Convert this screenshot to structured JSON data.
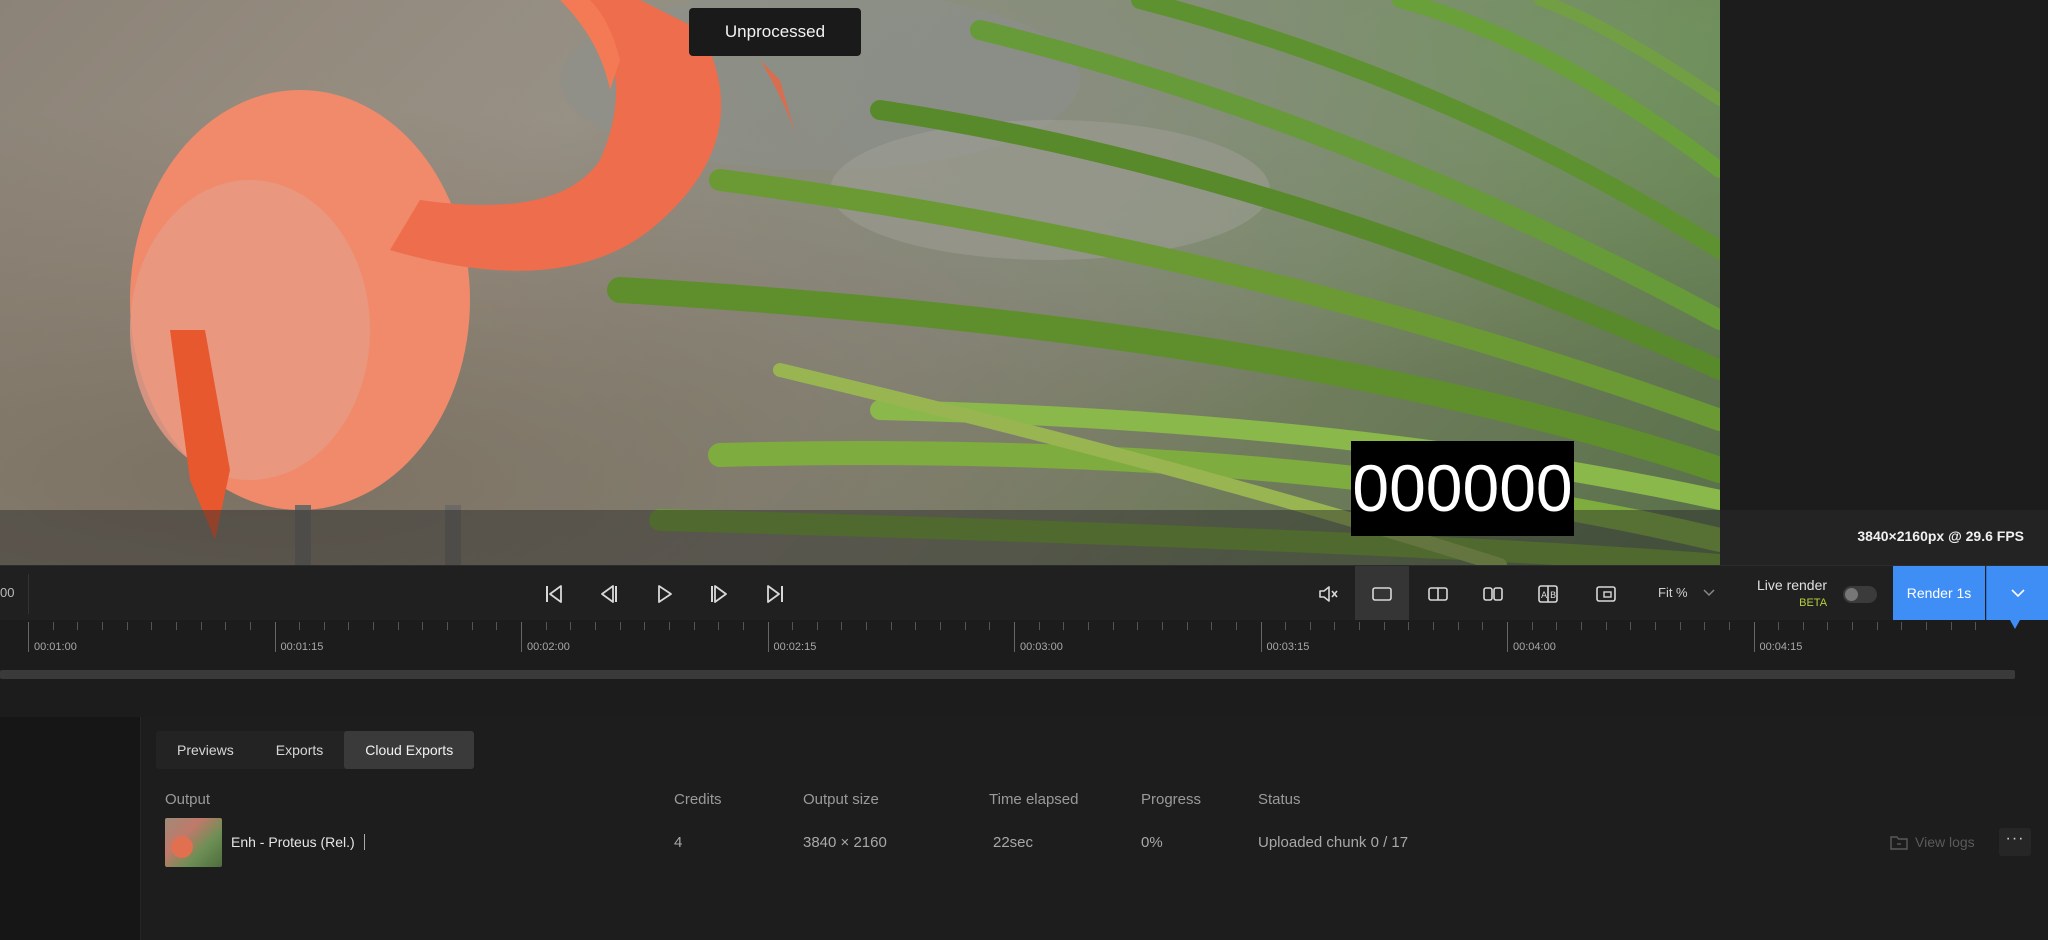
{
  "preview": {
    "comparison_label": "Unprocessed",
    "frame_counter": "000000",
    "resolution": "3840×2160px @ 29.6 FPS"
  },
  "toolbar": {
    "left_time_fragment": "00",
    "fit_label": "Fit %",
    "live_render_label": "Live render",
    "live_render_badge": "BETA",
    "live_render_enabled": false,
    "render_button_label": "Render 1s",
    "icons": {
      "first_frame": "skip-to-start-icon",
      "prev_frame": "step-back-icon",
      "play": "play-icon",
      "next_frame": "step-forward-icon",
      "last_frame": "skip-to-end-icon",
      "mute": "speaker-muted-icon",
      "single_view": "single-view-icon",
      "split_view": "split-view-icon",
      "side_by_side": "side-by-side-icon",
      "compare_ab": "compare-ab-icon",
      "crop": "crop-icon"
    }
  },
  "timeline": {
    "tick_labels": [
      "00:01:00",
      "00:01:15",
      "00:02:00",
      "00:02:15",
      "00:03:00",
      "00:03:15",
      "00:04:00",
      "00:04:15"
    ]
  },
  "bottom_panel": {
    "tabs": [
      "Previews",
      "Exports",
      "Cloud Exports"
    ],
    "active_tab": "Cloud Exports",
    "columns": {
      "output": "Output",
      "credits": "Credits",
      "output_size": "Output size",
      "time_elapsed": "Time elapsed",
      "progress": "Progress",
      "status": "Status"
    },
    "rows": [
      {
        "output": "Enh - Proteus (Rel.)",
        "credits": "4",
        "output_size": "3840 × 2160",
        "time_elapsed": "22sec",
        "progress": "0%",
        "status": "Uploaded chunk 0 / 17",
        "view_logs_label": "View logs",
        "more_label": "···"
      }
    ]
  },
  "colors": {
    "accent": "#3f8ef5",
    "beta": "#b4d23a",
    "background": "#1c1c1c"
  }
}
